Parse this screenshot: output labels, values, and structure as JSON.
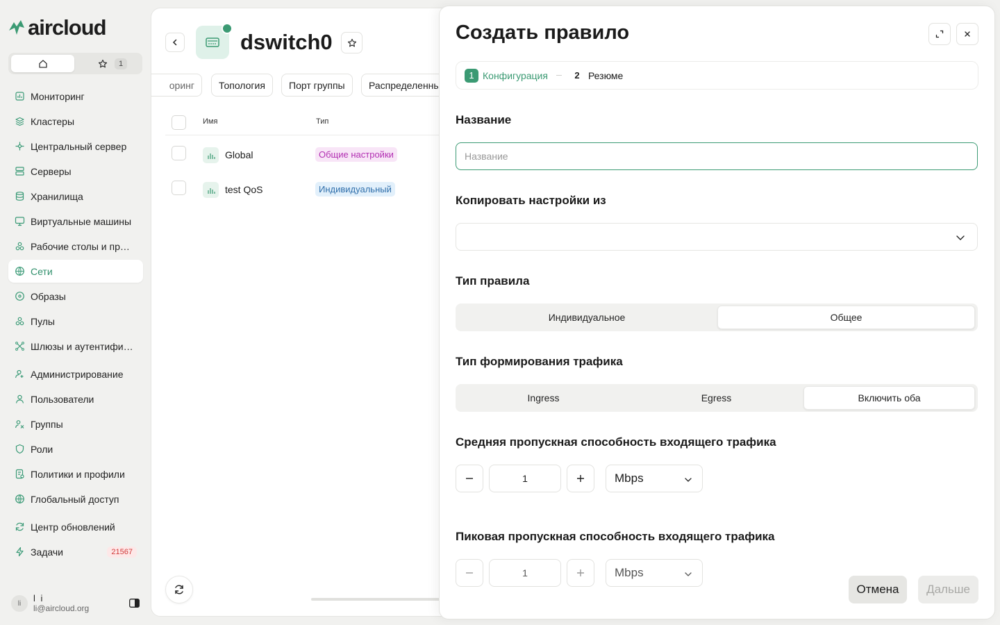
{
  "app": {
    "logo_text": "aircloud"
  },
  "switcher": {
    "fav_count": "1"
  },
  "sidebar": {
    "items": [
      {
        "label": "Мониторинг",
        "icon": "chart-icon"
      },
      {
        "label": "Кластеры",
        "icon": "layers-icon"
      },
      {
        "label": "Центральный сервер",
        "icon": "hub-icon"
      },
      {
        "label": "Серверы",
        "icon": "server-icon"
      },
      {
        "label": "Хранилища",
        "icon": "database-icon"
      },
      {
        "label": "Виртуальные машины",
        "icon": "monitor-icon"
      },
      {
        "label": "Рабочие столы и прил...",
        "icon": "apps-icon"
      },
      {
        "label": "Сети",
        "icon": "globe-icon",
        "active": true
      },
      {
        "label": "Образы",
        "icon": "disc-icon"
      },
      {
        "label": "Пулы",
        "icon": "pool-icon"
      },
      {
        "label": "Шлюзы и аутентифика...",
        "icon": "gateway-icon"
      },
      {
        "label": "Администрирование",
        "icon": "admin-icon"
      },
      {
        "label": "Пользователи",
        "icon": "user-icon"
      },
      {
        "label": "Группы",
        "icon": "group-icon"
      },
      {
        "label": "Роли",
        "icon": "shield-icon"
      },
      {
        "label": "Политики и профили",
        "icon": "policy-icon"
      },
      {
        "label": "Глобальный доступ",
        "icon": "world-icon"
      },
      {
        "label": "Центр обновлений",
        "icon": "refresh-icon"
      },
      {
        "label": "Задачи",
        "icon": "bolt-icon",
        "badge": "21567"
      }
    ]
  },
  "user": {
    "initials": "li",
    "name": "l i",
    "email": "li@aircloud.org"
  },
  "main": {
    "title": "dswitch0",
    "tabs": [
      "оринг",
      "Топология",
      "Порт группы",
      "Распределенны"
    ],
    "columns": {
      "name": "Имя",
      "type": "Тип"
    },
    "rows": [
      {
        "name": "Global",
        "type": "Общие настройки",
        "type_color": "purple"
      },
      {
        "name": "test QoS",
        "type": "Индивидуальный",
        "type_color": "blue"
      }
    ]
  },
  "drawer": {
    "title": "Создать правило",
    "steps": [
      {
        "num": "1",
        "label": "Конфигурация",
        "active": true
      },
      {
        "num": "2",
        "label": "Резюме",
        "active": false
      }
    ],
    "name_label": "Название",
    "name_placeholder": "Название",
    "copy_label": "Копировать настройки из",
    "copy_value": "",
    "rule_type_label": "Тип правила",
    "rule_type_options": [
      "Индивидуальное",
      "Общее"
    ],
    "rule_type_selected": "Общее",
    "shaping_label": "Тип формирования трафика",
    "shaping_options": [
      "Ingress",
      "Egress",
      "Включить оба"
    ],
    "shaping_selected": "Включить оба",
    "avg_label": "Средняя пропускная способность входящего трафика",
    "avg_value": "1",
    "avg_unit": "Mbps",
    "peak_label": "Пиковая пропускная способность входящего трафика",
    "peak_value": "1",
    "peak_unit": "Mbps",
    "cancel_label": "Отмена",
    "next_label": "Дальше"
  },
  "colors": {
    "accent": "#3b9a73",
    "badge_red": "#d23b3b"
  }
}
